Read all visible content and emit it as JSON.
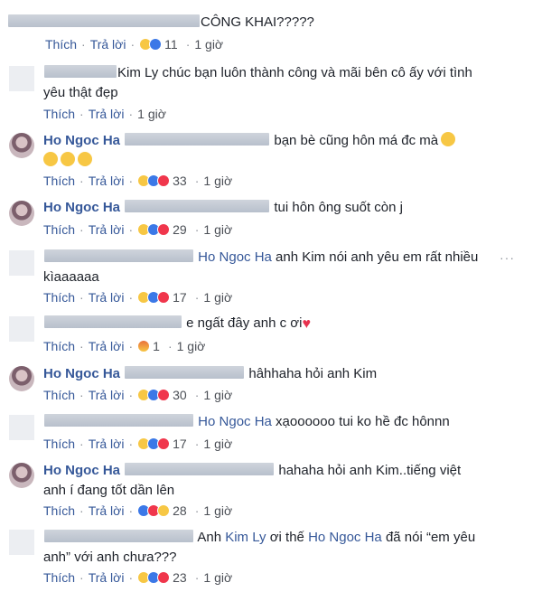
{
  "actions": {
    "like": "Thích",
    "reply": "Trả lời",
    "dot": "·"
  },
  "comments": [
    {
      "line1_after": "CÔNG KHAI?????",
      "count": "11",
      "time": "1 giờ"
    },
    {
      "line1_after": "Kim Ly chúc bạn luôn thành công và mãi bên cô ấy với tình",
      "line2": "yêu thật đẹp",
      "time": "1 giờ"
    },
    {
      "author": "Ho Ngoc Ha",
      "line1_after": "bạn bè cũng hôn má đc mà",
      "count": "33",
      "time": "1 giờ"
    },
    {
      "author": "Ho Ngoc Ha",
      "line1_after": "tui hôn ông suốt còn j",
      "count": "29",
      "time": "1 giờ"
    },
    {
      "tag": "Ho Ngoc Ha",
      "line1_after": "anh Kim nói anh yêu em rất nhiều",
      "line2": "kìaaaaaa",
      "count": "17",
      "time": "1 giờ",
      "more": "···"
    },
    {
      "line1_after": "e ngất đây anh c ơi",
      "count": "1",
      "time": "1 giờ"
    },
    {
      "author": "Ho Ngoc Ha",
      "line1_after": "hâhhaha hỏi anh Kim",
      "count": "30",
      "time": "1 giờ"
    },
    {
      "tag": "Ho Ngoc Ha",
      "line1_after": "xạoooooo tui ko hề đc hônnn",
      "count": "17",
      "time": "1 giờ"
    },
    {
      "author": "Ho Ngoc Ha",
      "line1_after": "hahaha hỏi anh Kim..tiếng việt",
      "line2": "anh í đang tốt dần lên",
      "count": "28",
      "time": "1 giờ"
    },
    {
      "line1_a": "Anh",
      "tag": "Kim Ly",
      "line1_b": "ơi thế",
      "tag2": "Ho Ngoc Ha",
      "line1_c": "đã nói “em yêu",
      "line2": "anh” với anh chưa???",
      "count": "23",
      "time": "1 giờ"
    }
  ]
}
